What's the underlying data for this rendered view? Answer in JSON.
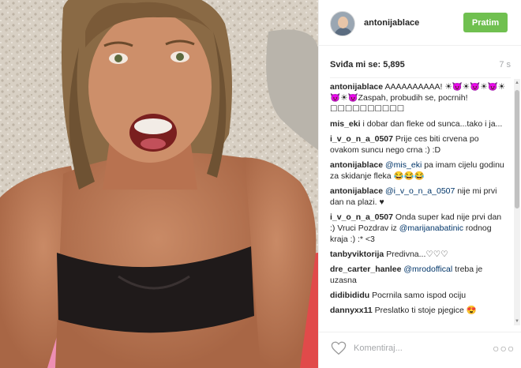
{
  "post": {
    "username": "antonijablace",
    "follow_label": "Pratim",
    "likes_text": "Sviđa mi se: 5,895",
    "time_ago": "7 s"
  },
  "comments": [
    {
      "author": "antonijablace",
      "parts": [
        {
          "t": "text",
          "v": " AAAAAAAAAA! ☀😈☀😈☀😈☀😈☀😈Zaspah, probudih se, pocrnih! ☐☐☐☐☐☐☐☐☐☐"
        }
      ]
    },
    {
      "author": "mis_eki",
      "parts": [
        {
          "t": "text",
          "v": " i dobar dan fleke od sunca...tako i ja..."
        }
      ]
    },
    {
      "author": "i_v_o_n_a_0507",
      "parts": [
        {
          "t": "text",
          "v": " Prije ces biti crvena po ovakom suncu nego crna :) :D"
        }
      ]
    },
    {
      "author": "antonijablace",
      "parts": [
        {
          "t": "mention",
          "v": " @mis_eki"
        },
        {
          "t": "text",
          "v": " pa imam cijelu godinu za skidanje fleka 😂😂😂"
        }
      ]
    },
    {
      "author": "antonijablace",
      "parts": [
        {
          "t": "mention",
          "v": " @i_v_o_n_a_0507"
        },
        {
          "t": "text",
          "v": " nije mi prvi dan na plazi. ♥"
        }
      ]
    },
    {
      "author": "i_v_o_n_a_0507",
      "parts": [
        {
          "t": "text",
          "v": " Onda super kad nije prvi dan :) Vruci Pozdrav iz "
        },
        {
          "t": "mention",
          "v": "@marijanabatinic"
        },
        {
          "t": "text",
          "v": " rodnog kraja :) :* <3"
        }
      ]
    },
    {
      "author": "tanbyviktorija",
      "parts": [
        {
          "t": "text",
          "v": " Predivna...♡♡♡"
        }
      ]
    },
    {
      "author": "dre_carter_hanlee",
      "parts": [
        {
          "t": "mention",
          "v": " @mrodoffical"
        },
        {
          "t": "text",
          "v": " treba je uzasna"
        }
      ]
    },
    {
      "author": "didibididu",
      "parts": [
        {
          "t": "text",
          "v": " Pocrnila samo ispod ociju"
        }
      ]
    },
    {
      "author": "dannyxx11",
      "parts": [
        {
          "t": "text",
          "v": " Preslatko ti stoje pjegice 😍"
        }
      ]
    }
  ],
  "footer": {
    "comment_placeholder": "Komentiraj...",
    "more_label": "○○○"
  },
  "icons": {
    "heart": "heart-outline-icon",
    "more": "more-options-icon"
  },
  "colors": {
    "follow_button": "#70c050",
    "mention": "#003569",
    "muted": "#a5a7aa"
  }
}
